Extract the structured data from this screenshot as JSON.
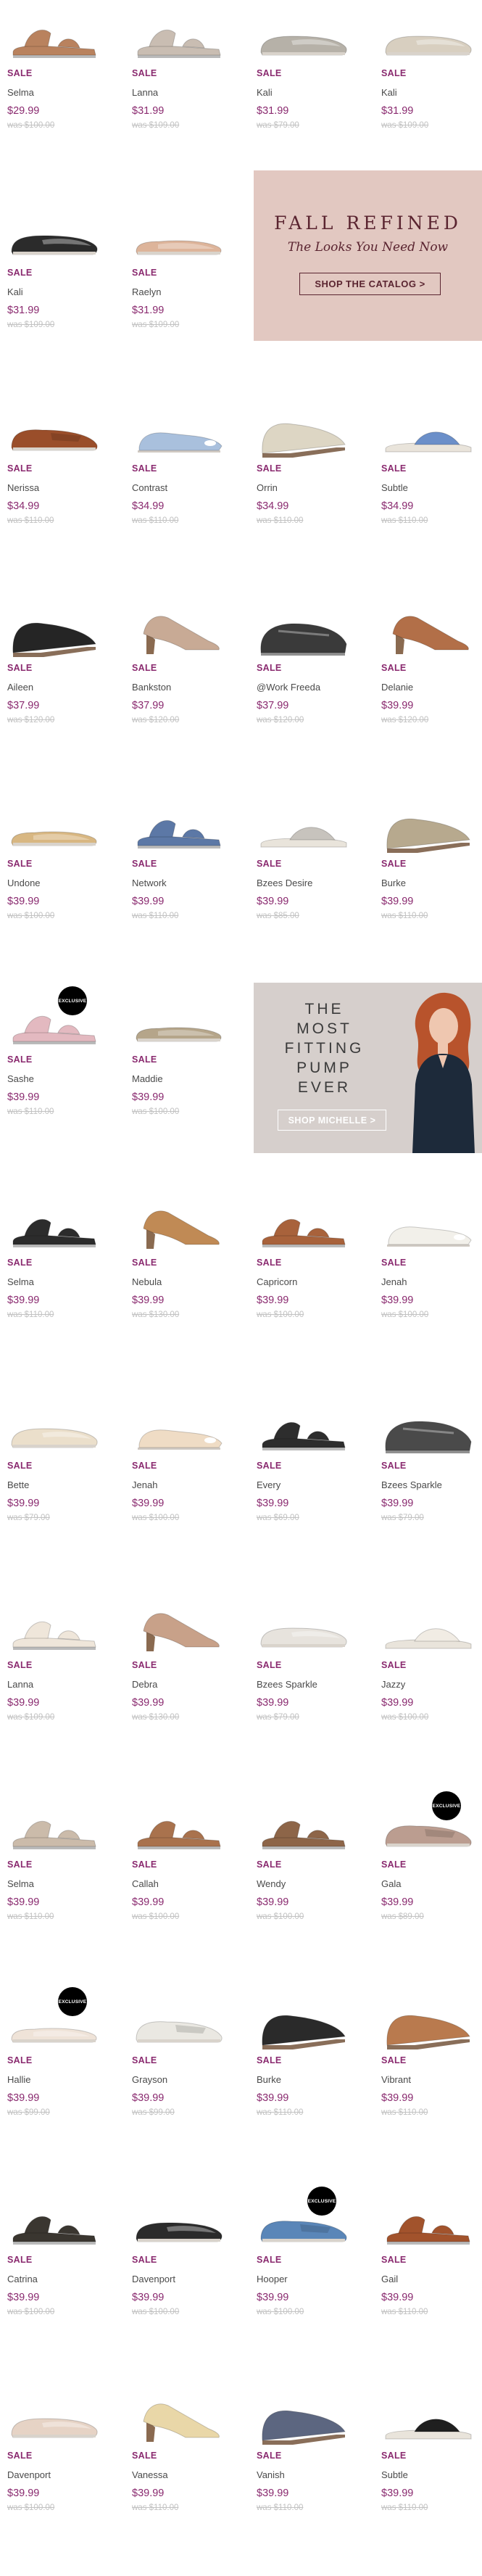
{
  "sale_label": "SALE",
  "exclusive_label": "EXCLUSIVE",
  "colors": {
    "accent": "#8a2a6f",
    "was_price": "#c2c2c2",
    "banner_fall": "#e2c8c1",
    "banner_pump": "#d6cfcc"
  },
  "banners": {
    "fall": {
      "title": "FALL REFINED",
      "subtitle": "The Looks You Need Now",
      "button": "SHOP THE CATALOG >"
    },
    "pump": {
      "line1": "THE",
      "line2": "MOST",
      "line3": "FITTING",
      "line4": "PUMP",
      "line5": "EVER",
      "button": "SHOP MICHELLE >"
    }
  },
  "products": [
    {
      "name": "Selma",
      "price": "$29.99",
      "was": "was $100.00",
      "color": "#b9825e",
      "style": "sandal"
    },
    {
      "name": "Lanna",
      "price": "$31.99",
      "was": "was $109.00",
      "color": "#c9bdb2",
      "style": "sandal"
    },
    {
      "name": "Kali",
      "price": "$31.99",
      "was": "was $79.00",
      "color": "#b6b1a8",
      "style": "slip"
    },
    {
      "name": "Kali",
      "price": "$31.99",
      "was": "was $109.00",
      "color": "#d8cfc0",
      "style": "slip"
    },
    {
      "name": "Kali",
      "price": "$31.99",
      "was": "was $109.00",
      "color": "#2b2b2b",
      "style": "slip"
    },
    {
      "name": "Raelyn",
      "price": "$31.99",
      "was": "was $109.00",
      "color": "#ddb49a",
      "style": "flat"
    },
    {
      "name": "Nerissa",
      "price": "$34.99",
      "was": "was $110.00",
      "color": "#9a4e2a",
      "style": "loafer"
    },
    {
      "name": "Contrast",
      "price": "$34.99",
      "was": "was $110.00",
      "color": "#a9c0dd",
      "style": "peep"
    },
    {
      "name": "Orrin",
      "price": "$34.99",
      "was": "was $110.00",
      "color": "#ddd6c4",
      "style": "wedge"
    },
    {
      "name": "Subtle",
      "price": "$34.99",
      "was": "was $110.00",
      "color": "#6b8fc9",
      "style": "slide"
    },
    {
      "name": "Aileen",
      "price": "$37.99",
      "was": "was $120.00",
      "color": "#252525",
      "style": "wedge"
    },
    {
      "name": "Bankston",
      "price": "$37.99",
      "was": "was $120.00",
      "color": "#c8aa95",
      "style": "heel"
    },
    {
      "name": "@Work Freeda",
      "price": "$37.99",
      "was": "was $120.00",
      "color": "#3a3a3a",
      "style": "clog"
    },
    {
      "name": "Delanie",
      "price": "$39.99",
      "was": "was $120.00",
      "color": "#b26f48",
      "style": "heel"
    },
    {
      "name": "Undone",
      "price": "$39.99",
      "was": "was $100.00",
      "color": "#d8b782",
      "style": "flat"
    },
    {
      "name": "Network",
      "price": "$39.99",
      "was": "was $110.00",
      "color": "#5c78a6",
      "style": "sandal"
    },
    {
      "name": "Bzees Desire",
      "price": "$39.99",
      "was": "was $85.00",
      "color": "#c7c3bd",
      "style": "slide"
    },
    {
      "name": "Burke",
      "price": "$39.99",
      "was": "was $110.00",
      "color": "#b7a98e",
      "style": "wedge"
    },
    {
      "name": "Sashe",
      "price": "$39.99",
      "was": "was $110.00",
      "color": "#e3b9c0",
      "style": "sandal",
      "exclusive": true
    },
    {
      "name": "Maddie",
      "price": "$39.99",
      "was": "was $100.00",
      "color": "#b5a58a",
      "style": "flat"
    },
    {
      "name": "Selma",
      "price": "$39.99",
      "was": "was $110.00",
      "color": "#2c2c2c",
      "style": "sandal"
    },
    {
      "name": "Nebula",
      "price": "$39.99",
      "was": "was $130.00",
      "color": "#c08a55",
      "style": "heel"
    },
    {
      "name": "Capricorn",
      "price": "$39.99",
      "was": "was $100.00",
      "color": "#a8623b",
      "style": "sandal"
    },
    {
      "name": "Jenah",
      "price": "$39.99",
      "was": "was $100.00",
      "color": "#f2f0ea",
      "style": "peep"
    },
    {
      "name": "Bette",
      "price": "$39.99",
      "was": "was $79.00",
      "color": "#ebdfcb",
      "style": "slip"
    },
    {
      "name": "Jenah",
      "price": "$39.99",
      "was": "was $100.00",
      "color": "#efdcc5",
      "style": "peep"
    },
    {
      "name": "Every",
      "price": "$39.99",
      "was": "was $69.00",
      "color": "#2d2d2d",
      "style": "sandal"
    },
    {
      "name": "Bzees Sparkle",
      "price": "$39.99",
      "was": "was $79.00",
      "color": "#4a4a4a",
      "style": "clog"
    },
    {
      "name": "Lanna",
      "price": "$39.99",
      "was": "was $109.00",
      "color": "#efe6da",
      "style": "sandal"
    },
    {
      "name": "Debra",
      "price": "$39.99",
      "was": "was $130.00",
      "color": "#c8a189",
      "style": "heel"
    },
    {
      "name": "Bzees Sparkle",
      "price": "$39.99",
      "was": "was $79.00",
      "color": "#e7e3dd",
      "style": "slip"
    },
    {
      "name": "Jazzy",
      "price": "$39.99",
      "was": "was $100.00",
      "color": "#f1ece4",
      "style": "slide"
    },
    {
      "name": "Selma",
      "price": "$39.99",
      "was": "was $110.00",
      "color": "#cbbbaa",
      "style": "sandal"
    },
    {
      "name": "Callah",
      "price": "$39.99",
      "was": "was $100.00",
      "color": "#a9724d",
      "style": "sandal"
    },
    {
      "name": "Wendy",
      "price": "$39.99",
      "was": "was $100.00",
      "color": "#8d6548",
      "style": "sandal"
    },
    {
      "name": "Gala",
      "price": "$39.99",
      "was": "was $89.00",
      "color": "#bb9d90",
      "style": "loafer",
      "exclusive": true
    },
    {
      "name": "Hallie",
      "price": "$39.99",
      "was": "was $99.00",
      "color": "#efe3d8",
      "style": "flat",
      "exclusive": true
    },
    {
      "name": "Grayson",
      "price": "$39.99",
      "was": "was $99.00",
      "color": "#eae8e2",
      "style": "loafer"
    },
    {
      "name": "Burke",
      "price": "$39.99",
      "was": "was $110.00",
      "color": "#2a2a2a",
      "style": "wedge"
    },
    {
      "name": "Vibrant",
      "price": "$39.99",
      "was": "was $110.00",
      "color": "#b97a4e",
      "style": "wedge"
    },
    {
      "name": "Catrina",
      "price": "$39.99",
      "was": "was $100.00",
      "color": "#3a3630",
      "style": "sandal"
    },
    {
      "name": "Davenport",
      "price": "$39.99",
      "was": "was $100.00",
      "color": "#2b2b2b",
      "style": "slip"
    },
    {
      "name": "Hooper",
      "price": "$39.99",
      "was": "was $100.00",
      "color": "#5a86b8",
      "style": "loafer",
      "exclusive": true
    },
    {
      "name": "Gail",
      "price": "$39.99",
      "was": "was $110.00",
      "color": "#a2532c",
      "style": "sandal"
    },
    {
      "name": "Davenport",
      "price": "$39.99",
      "was": "was $100.00",
      "color": "#e6d3c5",
      "style": "slip"
    },
    {
      "name": "Vanessa",
      "price": "$39.99",
      "was": "was $110.00",
      "color": "#e9d7a8",
      "style": "heel"
    },
    {
      "name": "Vanish",
      "price": "$39.99",
      "was": "was $110.00",
      "color": "#5c6680",
      "style": "wedge"
    },
    {
      "name": "Subtle",
      "price": "$39.99",
      "was": "was $110.00",
      "color": "#1f1f1f",
      "style": "slide"
    }
  ]
}
